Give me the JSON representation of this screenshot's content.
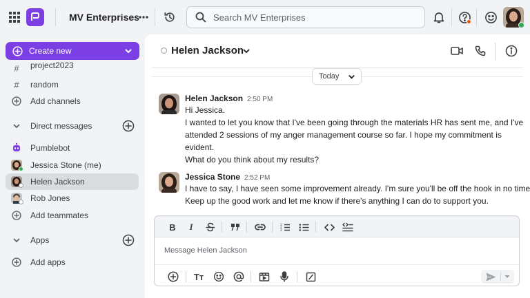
{
  "topbar": {
    "workspace_name": "MV Enterprises",
    "search_placeholder": "Search MV Enterprises"
  },
  "sidebar": {
    "create_label": "Create new",
    "channels": [
      {
        "name": "project2023"
      },
      {
        "name": "random"
      }
    ],
    "add_channels": "Add channels",
    "direct_messages_label": "Direct messages",
    "dms": [
      {
        "name": "Pumblebot"
      },
      {
        "name": "Jessica Stone (me)"
      },
      {
        "name": "Helen Jackson"
      },
      {
        "name": "Rob Jones"
      }
    ],
    "add_teammates": "Add teammates",
    "apps_label": "Apps",
    "add_apps": "Add apps"
  },
  "conversation": {
    "title": "Helen Jackson",
    "date_divider": "Today",
    "messages": [
      {
        "author": "Helen Jackson",
        "time": "2:50 PM",
        "lines": [
          "Hi Jessica.",
          "I wanted to let you know that I've been going through the materials HR has sent me, and I've",
          "attended 2 sessions of my anger management course so far. I hope my commitment is",
          "evident.",
          "What do you think about my results?"
        ]
      },
      {
        "author": "Jessica Stone",
        "time": "2:52 PM",
        "lines": [
          "I have to say, I have seen some improvement already. I'm sure you'll be off the hook in no time.",
          "Keep up the good work and let me know if there's anything I can do to support you."
        ]
      }
    ]
  },
  "composer": {
    "placeholder": "Message Helen Jackson",
    "format_glyphs": {
      "bold": "B",
      "italic": "I",
      "text_size": "Tт"
    }
  },
  "colors": {
    "brand_purple": "#7b3fe4",
    "online_green": "#34a853",
    "notification_orange": "#e8590c"
  }
}
